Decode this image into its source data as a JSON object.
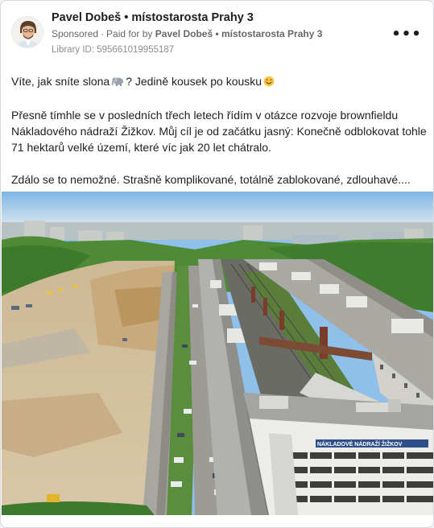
{
  "post": {
    "author": "Pavel Dobeš • místostarosta Prahy 3",
    "sponsored_label": "Sponsored",
    "paid_for_label": "Paid for by",
    "paid_for_name": "Pavel Dobeš • místostarosta Prahy 3",
    "library_id": "Library ID: 595661019955187",
    "more_icon": "more-horizontal-icon",
    "text": {
      "line1_a": "Víte, jak sníte slona",
      "line1_b": "? Jedině kousek po kousku",
      "para2_line1": "Přesně tímhle se v posledních třech letech řídím v otázce rozvoje brownfieldu",
      "para2_line2": "Nákladového nádraží Žižkov. Můj cíl je od začátku jasný: Konečně odblokovat tohle",
      "para2_line3": "71 hektarů velké území, které víc jak 20 let chátralo.",
      "para3_line1": "Zdálo se to nemožné. Strašně komplikované, totálně zablokované, zdlouhavé...."
    },
    "emojis": [
      "elephant-emoji",
      "smiling-face-emoji"
    ],
    "photo": {
      "sign_text": "NÁKLADOVÉ NÁDRAŽÍ ŽIŽKOV"
    }
  },
  "colors": {
    "link_text": "#1c1e21",
    "secondary_text": "#65676b",
    "sky": "#8fc0ea",
    "roof_grey": "#a9aaa6",
    "dirt": "#d8c3a0",
    "greenery": "#3d7a2e"
  }
}
